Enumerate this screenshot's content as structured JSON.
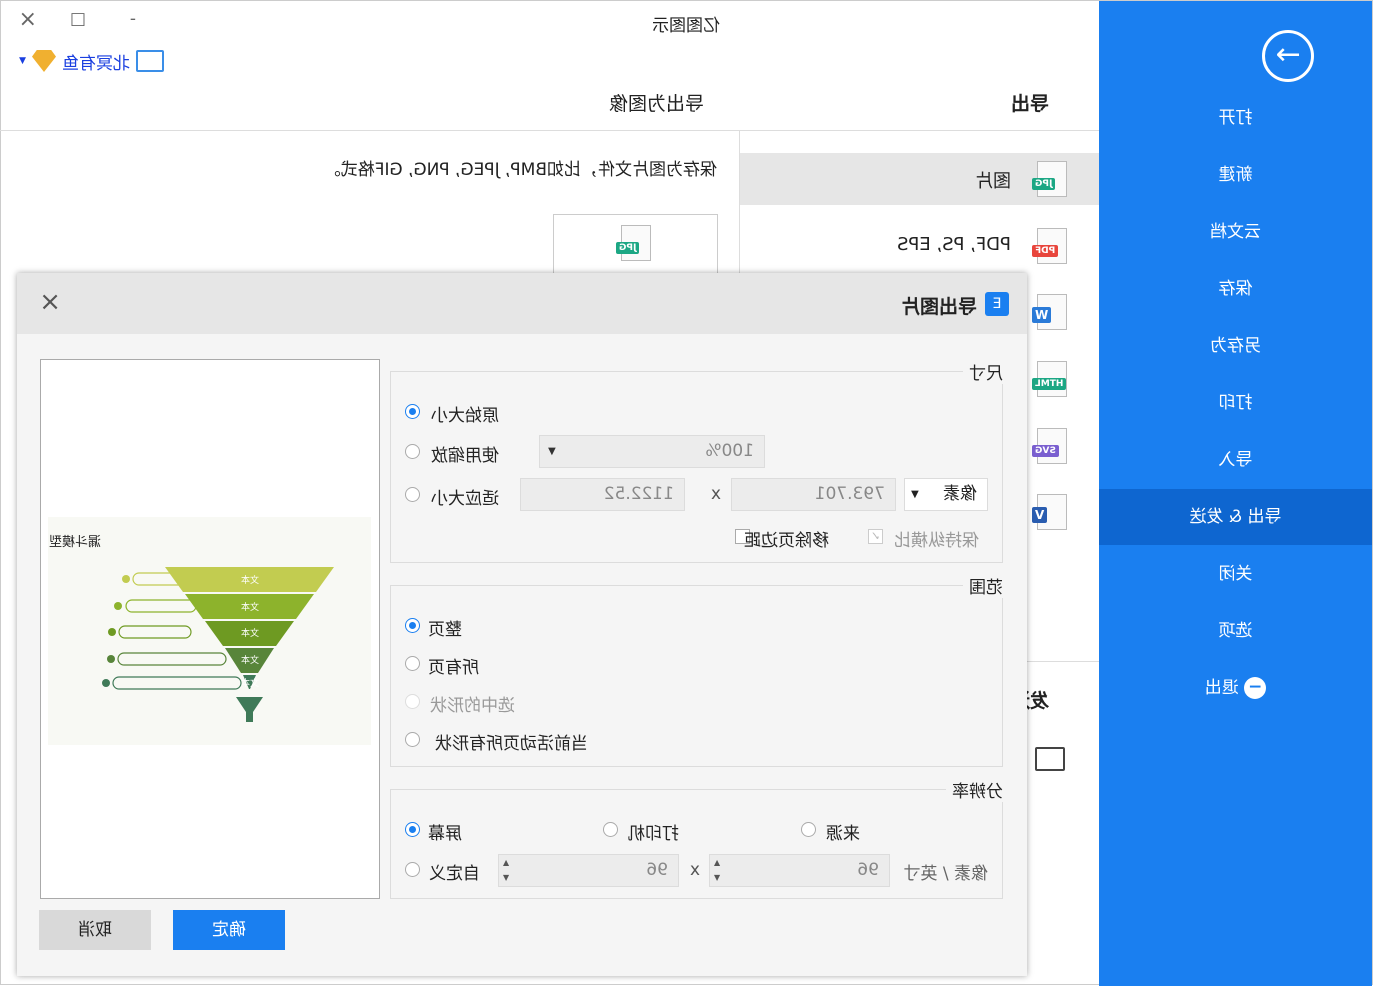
{
  "app_title": "亿图图示",
  "window_controls": {
    "minimize": "-",
    "maximize": "□",
    "close": "×"
  },
  "user": {
    "name": "北冥有鱼"
  },
  "colors": {
    "sidebar": "#1a7ff0",
    "sidebar_selected": "#0e66d0",
    "primary_button": "#1a7ff0"
  },
  "sidebar": {
    "items": [
      {
        "label": "打开",
        "icon": "arrow-right-circle-icon"
      },
      {
        "label": "新建"
      },
      {
        "label": "云文档"
      },
      {
        "label": "保存"
      },
      {
        "label": "另存为"
      },
      {
        "label": "打印"
      },
      {
        "label": "导入"
      },
      {
        "label": "导出 & 发送",
        "selected": true
      },
      {
        "label": "关闭"
      },
      {
        "label": "选项"
      },
      {
        "label": "退出",
        "icon": "minus-circle-icon"
      }
    ]
  },
  "export": {
    "heading": "导出",
    "subheading": "导出为图像",
    "description": "保存为图片文件，比如BMP, JPEG, PNG, GIF格式。",
    "items": [
      {
        "label": "图片",
        "badge": "JPG",
        "color": "#1ca784"
      },
      {
        "label": "PDF, PS, EPS",
        "badge": "PDF",
        "color": "#e8453c"
      },
      {
        "label": "",
        "badge": "W",
        "color": "#2b7bd8"
      },
      {
        "label": "",
        "badge": "HTML",
        "color": "#1ca784"
      },
      {
        "label": "",
        "badge": "SVG",
        "color": "#7a5fd0"
      },
      {
        "label": "",
        "badge": "V",
        "color": "#2a5db0"
      }
    ],
    "send_heading": "发送",
    "preview_badge": "JPG"
  },
  "dialog": {
    "title": "导出图片",
    "close": "×",
    "size": {
      "title": "尺寸",
      "original": "原始大小",
      "use_zoom": "使用缩放",
      "zoom_value": "100%",
      "fit": "适应大小",
      "width": "1122.52",
      "x": "x",
      "height": "793.701",
      "unit": "像素",
      "remove_margin": "移除页边距",
      "keep_ratio": "保持纵横比",
      "selected": "original"
    },
    "range": {
      "title": "范围",
      "options": [
        "整页",
        "所有页",
        "选中的形状",
        "当前活动页所有形状"
      ],
      "selected": 0
    },
    "resolution": {
      "title": "分辨率",
      "screen": "屏幕",
      "printer": "打印机",
      "source": "来源",
      "custom": "自定义",
      "dpi_x": "96",
      "x": "x",
      "dpi_y": "96",
      "unit": "像素 / 英寸",
      "selected": "screen"
    },
    "ok": "确定",
    "cancel": "取消",
    "preview": {
      "title": "漏斗模型",
      "layer_label": "文本"
    }
  }
}
